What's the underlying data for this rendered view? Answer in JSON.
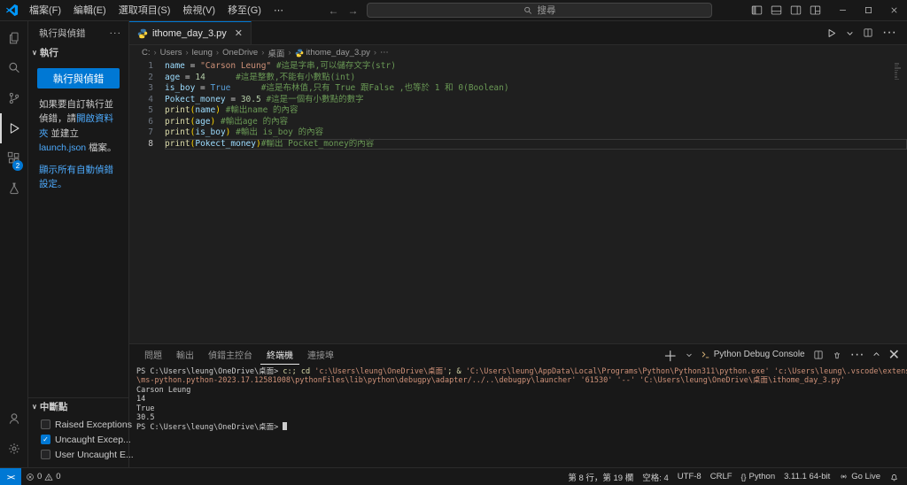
{
  "titlebar": {
    "menus": [
      {
        "id": "file",
        "label": "檔案(F)"
      },
      {
        "id": "edit",
        "label": "編輯(E)"
      },
      {
        "id": "selection",
        "label": "選取項目(S)"
      },
      {
        "id": "view",
        "label": "檢視(V)"
      },
      {
        "id": "go",
        "label": "移至(G)"
      },
      {
        "id": "more",
        "label": "⋯"
      }
    ],
    "search_label": "搜尋"
  },
  "activitybar": {
    "items": [
      {
        "name": "explorer",
        "active": false
      },
      {
        "name": "search",
        "active": false
      },
      {
        "name": "source-control",
        "active": false
      },
      {
        "name": "run-and-debug",
        "active": true
      },
      {
        "name": "extensions",
        "active": false,
        "badge": "2"
      },
      {
        "name": "testing",
        "active": false
      }
    ],
    "bottom": [
      {
        "name": "account"
      },
      {
        "name": "settings"
      }
    ]
  },
  "sidebar": {
    "title": "執行與偵錯",
    "run_section": "執行",
    "run_button": "執行與偵錯",
    "hint": {
      "pre": "如果要自訂執行並偵錯，請",
      "link_folder": "開啟資料夾",
      "mid": " 並建立 ",
      "link_launch": "launch.json",
      "post": " 檔案。"
    },
    "show_all_link": "顯示所有自動偵錯設定。",
    "breakpoints_title": "中斷點",
    "breakpoints": [
      {
        "id": "raised-exceptions",
        "label": "Raised Exceptions",
        "checked": false
      },
      {
        "id": "uncaught-exceptions",
        "label": "Uncaught Excep...",
        "checked": true
      },
      {
        "id": "user-uncaught-exceptions",
        "label": "User Uncaught E...",
        "checked": false
      }
    ]
  },
  "editor": {
    "tab_label": "ithome_day_3.py",
    "breadcrumb": [
      "C:",
      "Users",
      "leung",
      "OneDrive",
      "桌面",
      "ithome_day_3.py",
      "⋯"
    ],
    "active_line": 8,
    "lines": [
      {
        "n": 1,
        "tokens": [
          [
            "v",
            "name"
          ],
          [
            "o",
            " = "
          ],
          [
            "s",
            "\"Carson Leung\""
          ],
          [
            "o",
            " "
          ],
          [
            "c",
            "#這是字串,可以儲存文字(str)"
          ]
        ]
      },
      {
        "n": 2,
        "tokens": [
          [
            "v",
            "age"
          ],
          [
            "o",
            " = "
          ],
          [
            "n",
            "14"
          ],
          [
            "o",
            "      "
          ],
          [
            "c",
            "#這是整數,不能有小數點(int)"
          ]
        ]
      },
      {
        "n": 3,
        "tokens": [
          [
            "v",
            "is_boy"
          ],
          [
            "o",
            " = "
          ],
          [
            "k",
            "True"
          ],
          [
            "o",
            "      "
          ],
          [
            "c",
            "#這是布林值,只有 True 跟False ,也等於 1 和 0(Boolean)"
          ]
        ]
      },
      {
        "n": 4,
        "tokens": [
          [
            "v",
            "Pokect_money"
          ],
          [
            "o",
            " = "
          ],
          [
            "n",
            "30.5"
          ],
          [
            "o",
            " "
          ],
          [
            "c",
            "#這是一個有小數點的數字"
          ]
        ]
      },
      {
        "n": 5,
        "tokens": [
          [
            "f",
            "print"
          ],
          [
            "b",
            "("
          ],
          [
            "v",
            "name"
          ],
          [
            "b",
            ")"
          ],
          [
            "o",
            " "
          ],
          [
            "c",
            "#輸出name 的內容"
          ]
        ]
      },
      {
        "n": 6,
        "tokens": [
          [
            "f",
            "print"
          ],
          [
            "b",
            "("
          ],
          [
            "v",
            "age"
          ],
          [
            "b",
            ")"
          ],
          [
            "o",
            " "
          ],
          [
            "c",
            "#輸出age 的內容"
          ]
        ]
      },
      {
        "n": 7,
        "tokens": [
          [
            "f",
            "print"
          ],
          [
            "b",
            "("
          ],
          [
            "v",
            "is_boy"
          ],
          [
            "b",
            ")"
          ],
          [
            "o",
            " "
          ],
          [
            "c",
            "#輸出 is_boy 的內容"
          ]
        ]
      },
      {
        "n": 8,
        "tokens": [
          [
            "f",
            "print"
          ],
          [
            "b",
            "("
          ],
          [
            "vu",
            "Pokect_money"
          ],
          [
            "b",
            ")"
          ],
          [
            "c",
            "#輸出 Pocket_money的內容"
          ]
        ]
      }
    ]
  },
  "panel": {
    "tabs": [
      {
        "id": "problems",
        "label": "問題"
      },
      {
        "id": "output",
        "label": "輸出"
      },
      {
        "id": "debug-console",
        "label": "偵錯主控台"
      },
      {
        "id": "terminal",
        "label": "終端機"
      },
      {
        "id": "ports",
        "label": "連接埠"
      }
    ],
    "active_tab": "terminal",
    "console_label": "Python Debug Console",
    "terminal_lines": [
      [
        [
          "p",
          "PS C:\\Users\\leung\\OneDrive\\桌面> "
        ],
        [
          "cmd",
          "c:; cd "
        ],
        [
          "str",
          "'c:\\Users\\leung\\OneDrive\\桌面'"
        ],
        [
          "cmd",
          "; & "
        ],
        [
          "str",
          "'C:\\Users\\leung\\AppData\\Local\\Programs\\Python\\Python311\\python.exe'"
        ],
        [
          "cmd",
          " "
        ],
        [
          "str",
          "'c:\\Users\\leung\\.vscode\\extensions"
        ]
      ],
      [
        [
          "str",
          "\\ms-python.python-2023.17.12581008\\pythonFiles\\lib\\python\\debugpy\\adapter/../..\\debugpy\\launcher'"
        ],
        [
          "cmd",
          " "
        ],
        [
          "str",
          "'61530'"
        ],
        [
          "cmd",
          " "
        ],
        [
          "str",
          "'--'"
        ],
        [
          "cmd",
          " "
        ],
        [
          "str",
          "'C:\\Users\\leung\\OneDrive\\桌面\\ithome_day_3.py'"
        ]
      ],
      [
        [
          "p",
          "Carson Leung"
        ]
      ],
      [
        [
          "p",
          "14"
        ]
      ],
      [
        [
          "p",
          "True"
        ]
      ],
      [
        [
          "p",
          "30.5"
        ]
      ],
      [
        [
          "p",
          "PS C:\\Users\\leung\\OneDrive\\桌面> "
        ],
        [
          "cursor",
          ""
        ]
      ]
    ]
  },
  "statusbar": {
    "errors": "0",
    "warnings": "0",
    "right": [
      {
        "id": "cursor-position",
        "label": "第 8 行，第 19 欄"
      },
      {
        "id": "indentation",
        "label": "空格: 4"
      },
      {
        "id": "encoding",
        "label": "UTF-8"
      },
      {
        "id": "eol",
        "label": "CRLF"
      },
      {
        "id": "language-mode",
        "label": "Python",
        "icon": "braces"
      },
      {
        "id": "interpreter",
        "label": "3.11.1 64-bit"
      },
      {
        "id": "go-live",
        "label": "Go Live",
        "icon": "broadcast"
      },
      {
        "id": "notifications",
        "label": "",
        "icon": "bell"
      }
    ]
  }
}
